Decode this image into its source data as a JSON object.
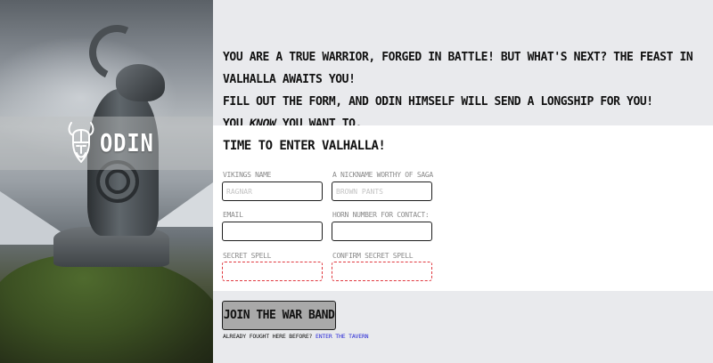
{
  "brand": {
    "name": "ODIN",
    "logo_icon": "viking-helmet-icon"
  },
  "intro": {
    "line1": "You are a true warrior, forged in battle! But what's next? The feast in Valhalla awaits you!",
    "line2": "Fill out the form, and Odin himself will send a longship for you!",
    "line3_before": "You ",
    "line3_emphasis": "know",
    "line3_after": " you want to."
  },
  "form": {
    "title": "Time to enter Valhalla!",
    "fields": {
      "first_name": {
        "label": "Vikings Name",
        "placeholder": "Ragnar",
        "value": ""
      },
      "last_name": {
        "label": "A nickname worthy of saga",
        "placeholder": "Brown Pants",
        "value": ""
      },
      "email": {
        "label": "Email",
        "placeholder": "",
        "value": ""
      },
      "phone": {
        "label": "Horn number for contact:",
        "placeholder": "",
        "value": ""
      },
      "password": {
        "label": "Secret spell",
        "placeholder": "",
        "value": ""
      },
      "confirm_password": {
        "label": "Confirm secret spell",
        "placeholder": "",
        "value": ""
      }
    },
    "submit_label": "Join the War Band",
    "signin_prompt": "Already fought here before?",
    "signin_link": "Enter the tavern"
  },
  "colors": {
    "page_bg": "#e9eaed",
    "form_bg": "#ffffff",
    "button_bg": "#a9a9a9",
    "invalid_border": "#e0383f",
    "link": "#2b2bd6"
  }
}
